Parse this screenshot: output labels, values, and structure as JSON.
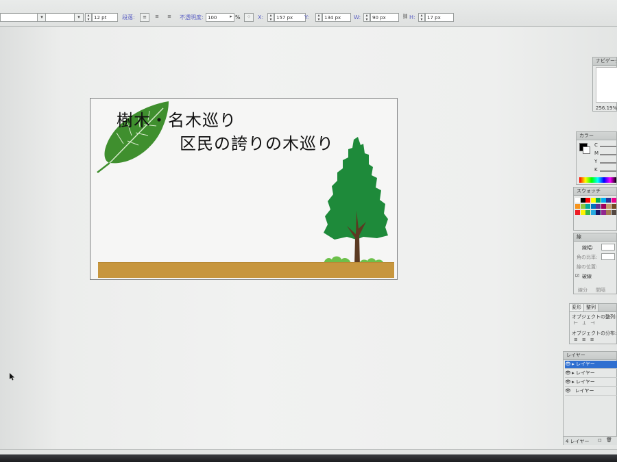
{
  "toolbar": {
    "font_size_value": "12 pt",
    "paragraph_label": "段落:",
    "opacity_label": "不透明度:",
    "opacity_value": "100",
    "opacity_unit": "%",
    "x_label": "X:",
    "x_value": "157 px",
    "y_label": "Y:",
    "y_value": "134 px",
    "w_label": "W:",
    "w_value": "90 px",
    "h_label": "H:",
    "h_value": "17 px"
  },
  "artboard": {
    "title_line1": "樹木・名木巡り",
    "title_line2": "区民の誇りの木巡り"
  },
  "colors": {
    "leaf": "#3f8f2e",
    "tree": "#1e8a3a",
    "trunk": "#5b3a22",
    "ground": "#c7963e",
    "bush": "#6cc04a"
  },
  "panels": {
    "navigator": {
      "title": "ナビゲータ",
      "zoom": "256.19%"
    },
    "color": {
      "title": "カラー",
      "channels": [
        "C",
        "M",
        "Y",
        "K"
      ]
    },
    "swatches": {
      "title": "スウォッチ"
    },
    "stroke": {
      "title": "線",
      "weight_label": "線幅:",
      "miter_label": "角の比率:",
      "cap_label": "線の位置:",
      "dashed_label": "破線",
      "dash_label": "線分",
      "gap_label": "間隔"
    },
    "align": {
      "tab_transform": "変形",
      "tab_align": "整列",
      "align_objects_label": "オブジェクトの整列:",
      "distribute_objects_label": "オブジェクトの分布:"
    },
    "layers": {
      "title": "レイヤー",
      "rows": [
        "レイヤー",
        "レイヤー",
        "レイヤー",
        "レイヤー"
      ],
      "footer": "4 レイヤー"
    }
  }
}
